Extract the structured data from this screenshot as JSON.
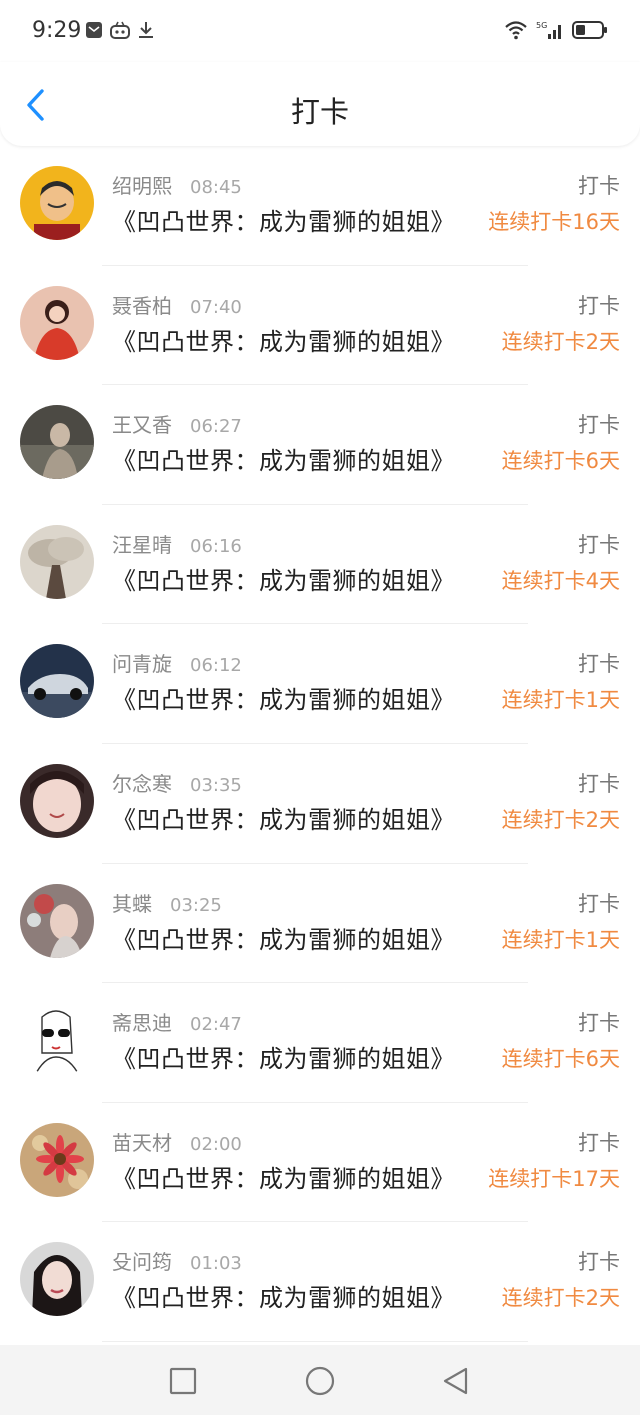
{
  "status": {
    "time": "9:29",
    "icons_left": [
      "message-icon",
      "game-icon",
      "download-icon"
    ],
    "icons_right": [
      "wifi-icon",
      "5g-signal-icon",
      "battery-icon"
    ]
  },
  "header": {
    "title": "打卡"
  },
  "colors": {
    "accent": "#1e90ff",
    "streak": "#f08a41"
  },
  "entries": [
    {
      "name": "绍明熙",
      "time": "08:45",
      "book": "《凹凸世界：成为雷狮的姐姐》",
      "action": "打卡",
      "streak": "连续打卡16天"
    },
    {
      "name": "聂香柏",
      "time": "07:40",
      "book": "《凹凸世界：成为雷狮的姐姐》",
      "action": "打卡",
      "streak": "连续打卡2天"
    },
    {
      "name": "王又香",
      "time": "06:27",
      "book": "《凹凸世界：成为雷狮的姐姐》",
      "action": "打卡",
      "streak": "连续打卡6天"
    },
    {
      "name": "汪星晴",
      "time": "06:16",
      "book": "《凹凸世界：成为雷狮的姐姐》",
      "action": "打卡",
      "streak": "连续打卡4天"
    },
    {
      "name": "问青旋",
      "time": "06:12",
      "book": "《凹凸世界：成为雷狮的姐姐》",
      "action": "打卡",
      "streak": "连续打卡1天"
    },
    {
      "name": "尔念寒",
      "time": "03:35",
      "book": "《凹凸世界：成为雷狮的姐姐》",
      "action": "打卡",
      "streak": "连续打卡2天"
    },
    {
      "name": "其蝶",
      "time": "03:25",
      "book": "《凹凸世界：成为雷狮的姐姐》",
      "action": "打卡",
      "streak": "连续打卡1天"
    },
    {
      "name": "斋思迪",
      "time": "02:47",
      "book": "《凹凸世界：成为雷狮的姐姐》",
      "action": "打卡",
      "streak": "连续打卡6天"
    },
    {
      "name": "苗天材",
      "time": "02:00",
      "book": "《凹凸世界：成为雷狮的姐姐》",
      "action": "打卡",
      "streak": "连续打卡17天"
    },
    {
      "name": "殳问筠",
      "time": "01:03",
      "book": "《凹凸世界：成为雷狮的姐姐》",
      "action": "打卡",
      "streak": "连续打卡2天"
    }
  ],
  "navbar": {
    "buttons": [
      "recent-apps-icon",
      "home-icon",
      "back-icon"
    ]
  }
}
